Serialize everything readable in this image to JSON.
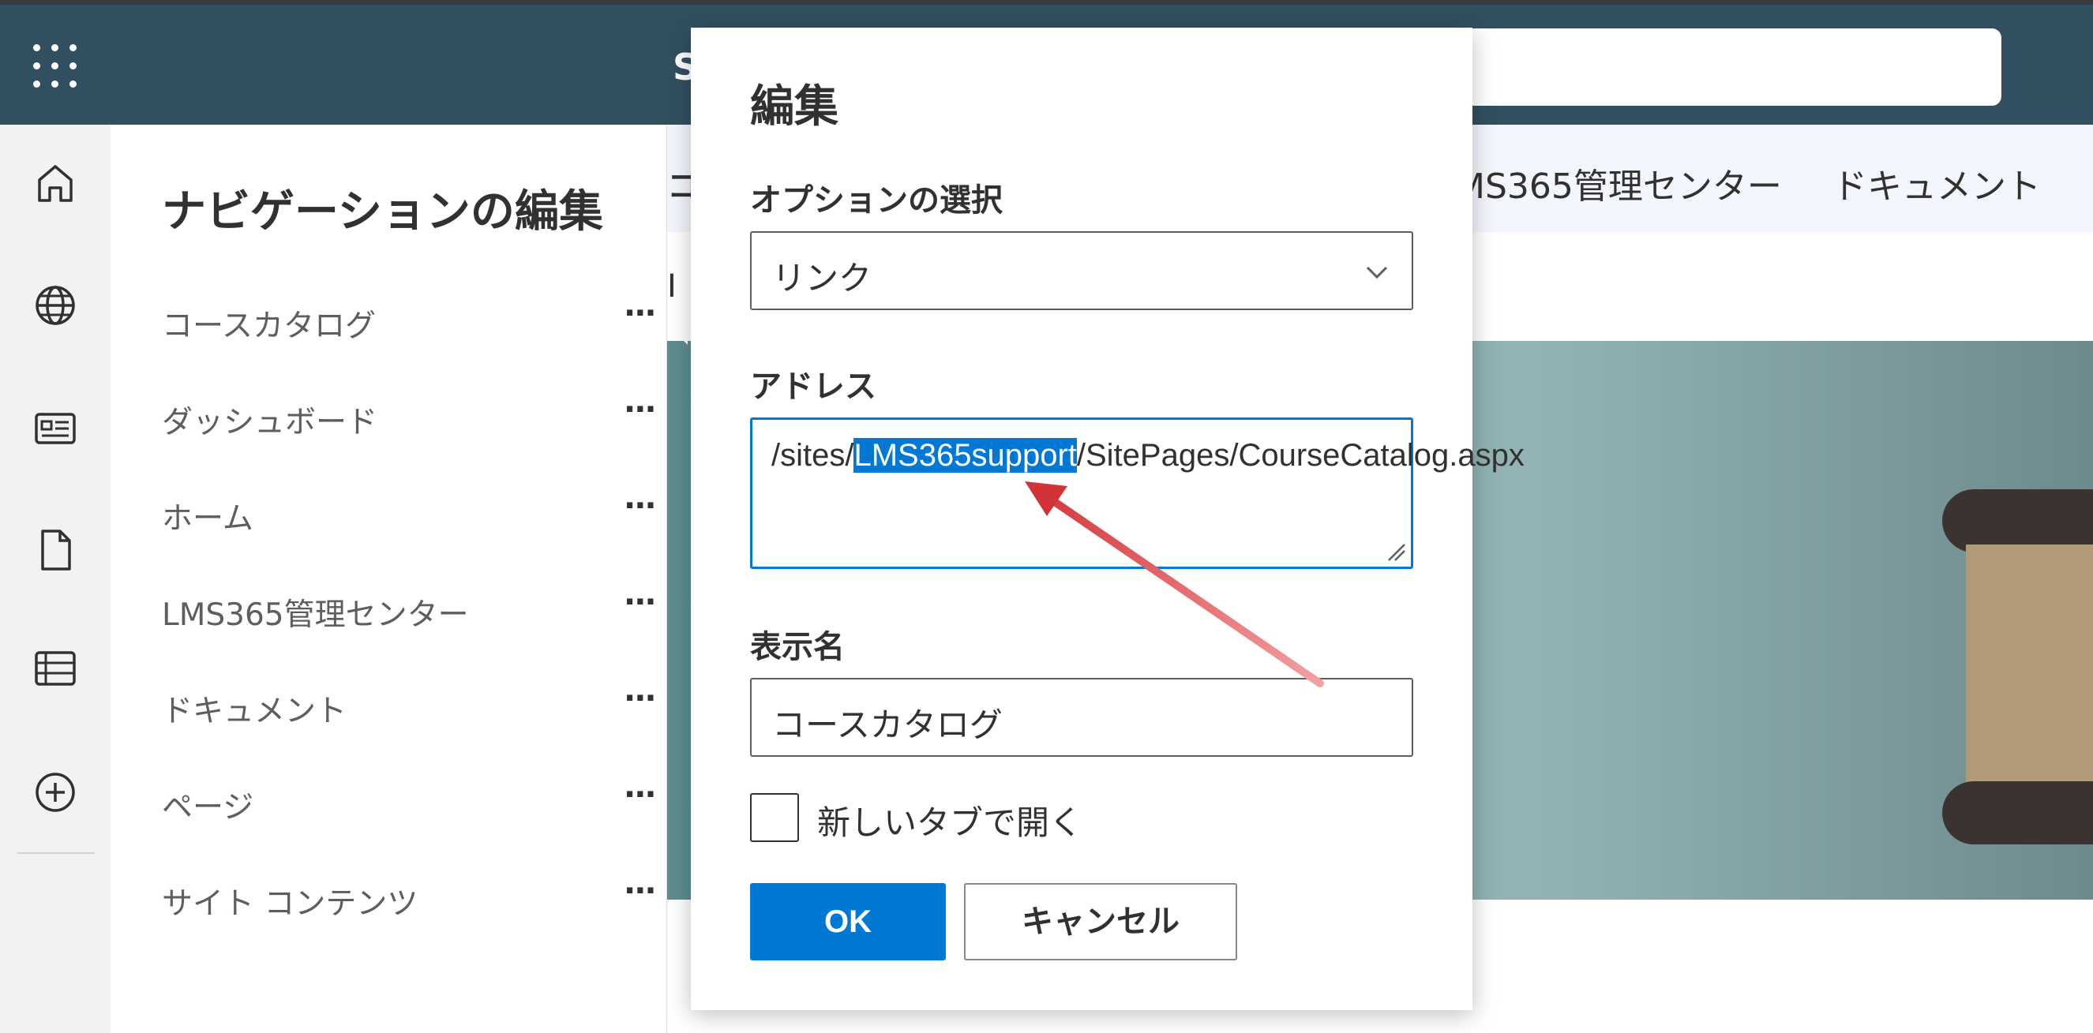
{
  "suite_bar": {
    "site_initial": "S"
  },
  "nav_panel": {
    "title": "ナビゲーションの編集",
    "more_label": "···",
    "items": [
      {
        "label": "コースカタログ"
      },
      {
        "label": "ダッシュボード"
      },
      {
        "label": "ホーム"
      },
      {
        "label": "LMS365管理センター"
      },
      {
        "label": "ドキュメント"
      },
      {
        "label": "ページ"
      },
      {
        "label": "サイト コンテンツ"
      }
    ]
  },
  "top_nav": {
    "first_fragment": "コ",
    "items": [
      {
        "label": "MS365管理センター"
      },
      {
        "label": "ドキュメント"
      }
    ],
    "hero_fragment": "I"
  },
  "dialog": {
    "title": "編集",
    "option_label": "オプションの選択",
    "option_value": "リンク",
    "address_label": "アドレス",
    "address_prefix": "/sites/",
    "address_selected": "LMS365support",
    "address_suffix": "/SitePages/CourseCatalog.aspx",
    "display_name_label": "表示名",
    "display_name_value": "コースカタログ",
    "new_tab_label": "新しいタブで開く",
    "new_tab_checked": false,
    "ok_label": "OK",
    "cancel_label": "キャンセル"
  },
  "colors": {
    "suite_bar": "#31505f",
    "accent": "#0078d4",
    "arrow": "#d13438"
  },
  "icons": [
    "waffle-icon",
    "home-icon",
    "globe-icon",
    "news-icon",
    "document-icon",
    "list-icon",
    "add-icon",
    "chevron-down-icon"
  ]
}
